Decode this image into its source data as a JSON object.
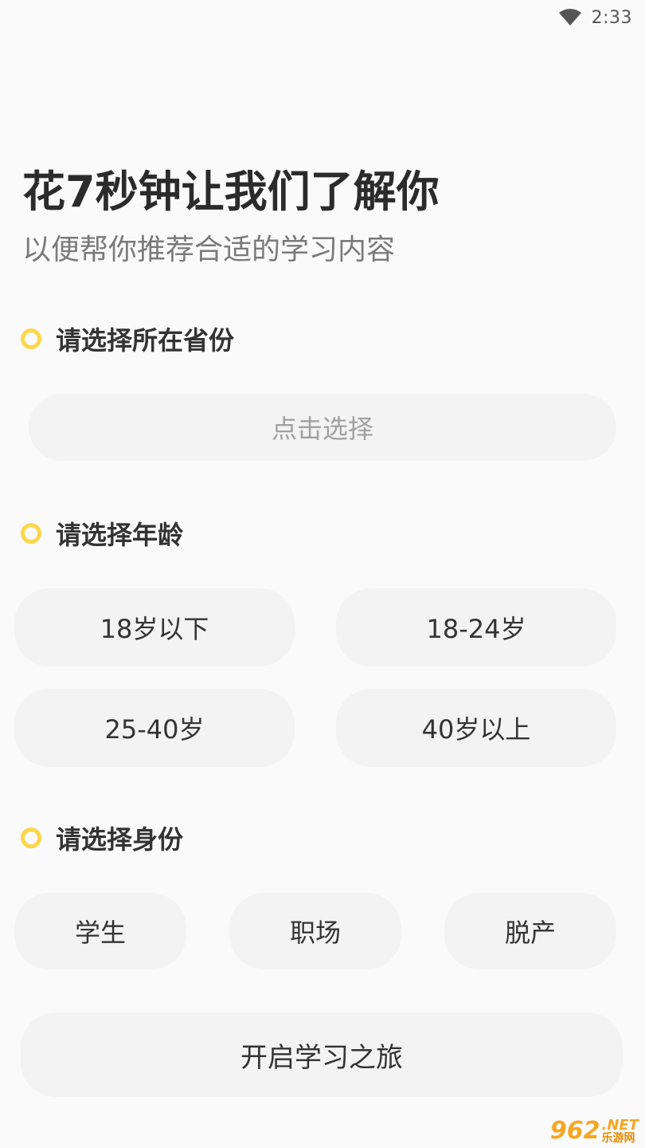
{
  "status_bar": {
    "time": "2:33",
    "wifi_icon": "wifi-icon"
  },
  "header": {
    "title": "花7秒钟让我们了解你",
    "subtitle": "以便帮你推荐合适的学习内容"
  },
  "colors": {
    "accent": "#ffd64a",
    "pill_bg": "#f3f3f3",
    "background": "#fafafa"
  },
  "province": {
    "label": "请选择所在省份",
    "placeholder": "点击选择"
  },
  "age": {
    "label": "请选择年龄",
    "options": [
      "18岁以下",
      "18-24岁",
      "25-40岁",
      "40岁以上"
    ]
  },
  "identity": {
    "label": "请选择身份",
    "options": [
      "学生",
      "职场",
      "脱产"
    ]
  },
  "submit": {
    "label": "开启学习之旅"
  },
  "watermark": {
    "number": "962",
    "net": ".NET",
    "cn": "乐游网"
  }
}
